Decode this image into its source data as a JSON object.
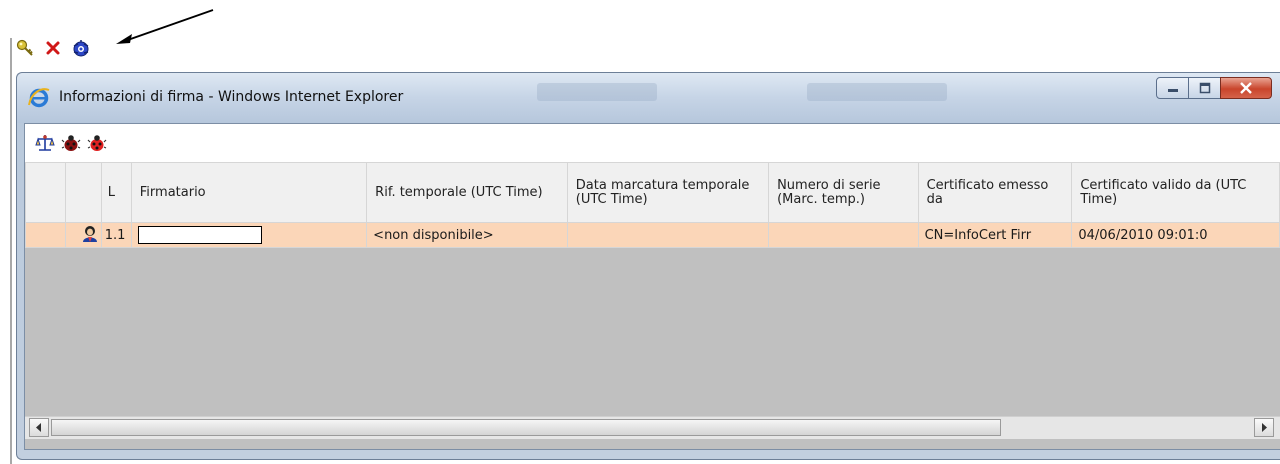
{
  "host_toolbar": {
    "icons": [
      "key-icon",
      "delete-icon",
      "signature-info-icon"
    ]
  },
  "window": {
    "title": "Informazioni di firma - Windows Internet Explorer",
    "buttons": [
      "minimize",
      "maximize",
      "close"
    ]
  },
  "inner_toolbar": {
    "icons": [
      "scales-icon",
      "ladybug-dark-icon",
      "ladybug-red-icon"
    ]
  },
  "table": {
    "headers": {
      "level": "L",
      "signer": "Firmatario",
      "time_ref": "Rif. temporale (UTC Time)",
      "timestamp_date": "Data marcatura temporale (UTC Time)",
      "serial": "Numero di serie (Marc. temp.)",
      "issuer": "Certificato emesso da",
      "valid_from": "Certificato valido da (UTC Time)"
    },
    "rows": [
      {
        "level": "1.1",
        "signer": "",
        "time_ref": "<non disponibile>",
        "timestamp_date": "",
        "serial": "",
        "issuer": "CN=InfoCert Firr",
        "valid_from": "04/06/2010 09:01:0"
      }
    ]
  },
  "colors": {
    "selected_row": "#fbd6b8",
    "header_bg": "#f0f0f0",
    "empty_area": "#c0c0c0"
  }
}
